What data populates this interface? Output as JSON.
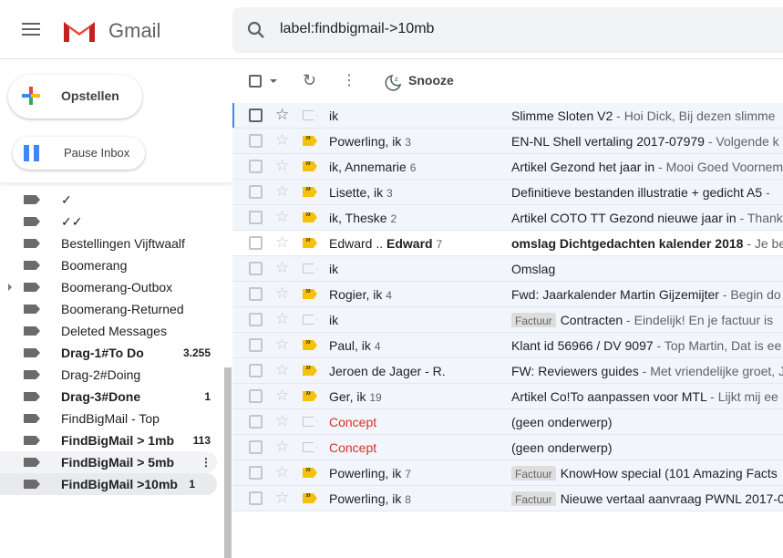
{
  "header": {
    "app_name": "Gmail",
    "search_value": "label:findbigmail->10mb"
  },
  "sidebar": {
    "compose_label": "Opstellen",
    "pause_label": "Pause Inbox",
    "labels": [
      {
        "name": "✓",
        "count": "",
        "bold": false
      },
      {
        "name": "✓✓",
        "count": "",
        "bold": false
      },
      {
        "name": "Bestellingen Vijftwaalf",
        "count": "",
        "bold": false
      },
      {
        "name": "Boomerang",
        "count": "",
        "bold": false
      },
      {
        "name": "Boomerang-Outbox",
        "count": "",
        "bold": false,
        "expandable": true
      },
      {
        "name": "Boomerang-Returned",
        "count": "",
        "bold": false
      },
      {
        "name": "Deleted Messages",
        "count": "",
        "bold": false
      },
      {
        "name": "Drag-1#To Do",
        "count": "3.255",
        "bold": true
      },
      {
        "name": "Drag-2#Doing",
        "count": "",
        "bold": false
      },
      {
        "name": "Drag-3#Done",
        "count": "1",
        "bold": true
      },
      {
        "name": "FindBigMail - Top",
        "count": "",
        "bold": false
      },
      {
        "name": "FindBigMail > 1mb",
        "count": "113",
        "bold": true
      },
      {
        "name": "FindBigMail > 5mb",
        "count": "",
        "bold": true,
        "hover": true
      },
      {
        "name": "FindBigMail >10mb",
        "count": "1",
        "bold": true,
        "selected": true
      }
    ]
  },
  "toolbar": {
    "snooze_label": "Snooze"
  },
  "emails": [
    {
      "sender": "ik",
      "n": "",
      "important": false,
      "subject": "Slimme Sloten V2",
      "snippet": " - Hoi Dick, Bij dezen slimme",
      "chip": ""
    },
    {
      "sender": "Powerling, ik",
      "n": "3",
      "important": true,
      "subject": "EN-NL Shell vertaling 2017-07979",
      "snippet": " - Volgende k",
      "chip": ""
    },
    {
      "sender": "ik, Annemarie",
      "n": "6",
      "important": true,
      "subject": "Artikel Gezond het jaar in",
      "snippet": " - Mooi Goed Voornem",
      "chip": ""
    },
    {
      "sender": "Lisette, ik",
      "n": "3",
      "important": true,
      "subject": "Definitieve bestanden illustratie + gedicht A5",
      "snippet": " - ",
      "chip": ""
    },
    {
      "sender": "ik, Theske",
      "n": "2",
      "important": true,
      "subject": "Artikel COTO TT Gezond nieuwe jaar in",
      "snippet": " - Thank",
      "chip": ""
    },
    {
      "sender": "Edward .. ",
      "sender_bold": "Edward",
      "n": "7",
      "important": true,
      "unread": true,
      "subject": "omslag Dichtgedachten kalender 2018",
      "snippet": " - Je ben",
      "chip": ""
    },
    {
      "sender": "ik",
      "n": "",
      "important": false,
      "subject": "Omslag",
      "snippet": "",
      "chip": ""
    },
    {
      "sender": "Rogier, ik",
      "n": "4",
      "important": true,
      "subject": "Fwd: Jaarkalender Martin Gijzemijter",
      "snippet": " - Begin do",
      "chip": ""
    },
    {
      "sender": "ik",
      "n": "",
      "important": false,
      "subject": "Contracten",
      "snippet": " - Eindelijk! En je factuur is",
      "chip": "Factuur"
    },
    {
      "sender": "Paul, ik",
      "n": "4",
      "important": true,
      "subject": "Klant id 56966 / DV 9097",
      "snippet": " - Top Martin, Dat is ee",
      "chip": ""
    },
    {
      "sender": "Jeroen de Jager - R.",
      "n": "",
      "important": true,
      "subject": "FW: Reviewers guides",
      "snippet": " - Met vriendelijke groet, J",
      "chip": ""
    },
    {
      "sender": "Ger, ik",
      "n": "19",
      "important": true,
      "subject": "Artikel Co!To aanpassen voor MTL",
      "snippet": " - Lijkt mij ee",
      "chip": ""
    },
    {
      "sender": "Concept",
      "n": "",
      "important": false,
      "draft": true,
      "subject": "(geen onderwerp)",
      "snippet": "",
      "chip": ""
    },
    {
      "sender": "Concept",
      "n": "",
      "important": false,
      "draft": true,
      "subject": "(geen onderwerp)",
      "snippet": "",
      "chip": ""
    },
    {
      "sender": "Powerling, ik",
      "n": "7",
      "important": true,
      "subject": "KnowHow special (101 Amazing Facts",
      "snippet": "",
      "chip": "Factuur"
    },
    {
      "sender": "Powerling, ik",
      "n": "8",
      "important": true,
      "subject": "Nieuwe vertaal aanvraag PWNL 2017-0",
      "snippet": "",
      "chip": "Factuur"
    }
  ]
}
